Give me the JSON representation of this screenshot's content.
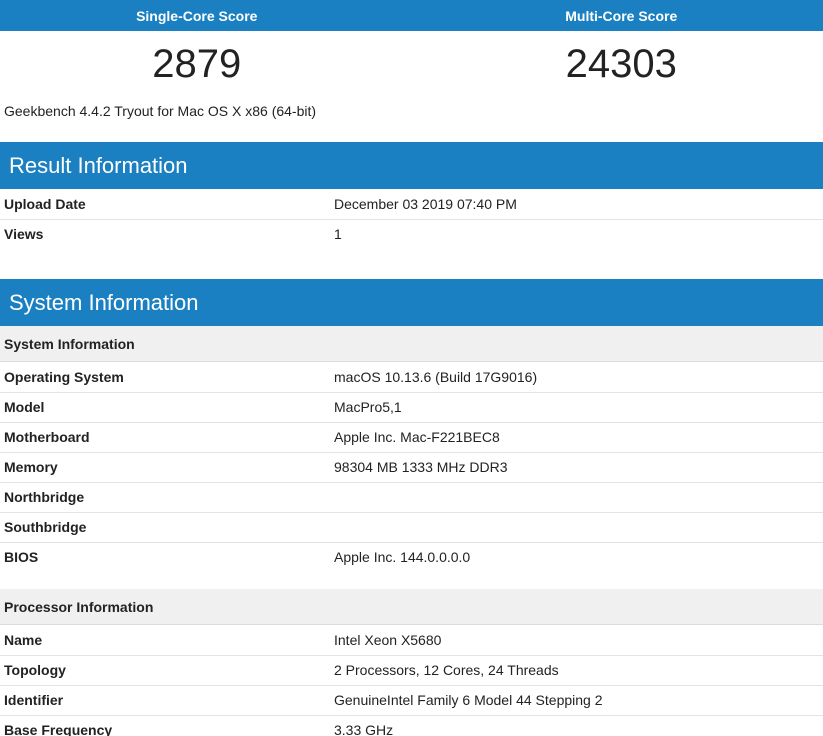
{
  "scores": {
    "single_label": "Single-Core Score",
    "multi_label": "Multi-Core Score",
    "single_value": "2879",
    "multi_value": "24303"
  },
  "version": "Geekbench 4.4.2 Tryout for Mac OS X x86 (64-bit)",
  "result_info": {
    "title": "Result Information",
    "rows": [
      {
        "label": "Upload Date",
        "value": "December 03 2019 07:40 PM"
      },
      {
        "label": "Views",
        "value": "1"
      }
    ]
  },
  "system_info": {
    "title": "System Information",
    "system_sub": "System Information",
    "system_rows": [
      {
        "label": "Operating System",
        "value": "macOS 10.13.6 (Build 17G9016)"
      },
      {
        "label": "Model",
        "value": "MacPro5,1"
      },
      {
        "label": "Motherboard",
        "value": "Apple Inc. Mac-F221BEC8"
      },
      {
        "label": "Memory",
        "value": "98304 MB 1333 MHz DDR3"
      },
      {
        "label": "Northbridge",
        "value": ""
      },
      {
        "label": "Southbridge",
        "value": ""
      },
      {
        "label": "BIOS",
        "value": "Apple Inc. 144.0.0.0.0"
      }
    ],
    "processor_sub": "Processor Information",
    "processor_rows": [
      {
        "label": "Name",
        "value": "Intel Xeon X5680"
      },
      {
        "label": "Topology",
        "value": "2 Processors, 12 Cores, 24 Threads"
      },
      {
        "label": "Identifier",
        "value": "GenuineIntel Family 6 Model 44 Stepping 2"
      },
      {
        "label": "Base Frequency",
        "value": "3.33 GHz"
      }
    ]
  },
  "colors": {
    "header_blue": "#1a80c2",
    "subheader_gray": "#f0f0f0"
  }
}
